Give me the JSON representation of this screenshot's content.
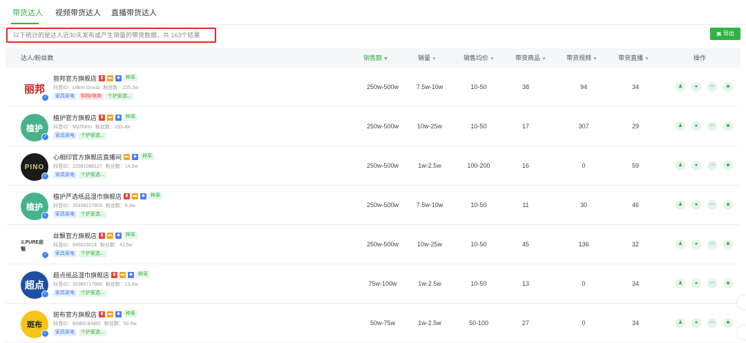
{
  "tabs": [
    {
      "label": "带货达人"
    },
    {
      "label": "视频带货达人"
    },
    {
      "label": "直播带货达人"
    }
  ],
  "notice": "以下统计的是达人近30天发布或产生销量的带货数据，共 163个结果",
  "export_label": "导出",
  "export_icon": "download-icon",
  "columns": {
    "influencer": "达人/粉丝数",
    "sales_amount": "销售额",
    "sales_volume": "销量",
    "avg_price": "销售均价",
    "products": "带货商品",
    "videos": "带货视频",
    "lives": "带货直播",
    "actions": "操作"
  },
  "sorted_column": "sales_amount",
  "accent_color": "#2fb344",
  "rows": [
    {
      "name": "丽邦官方旗舰店",
      "id": "抖音ID：LiBon.Group",
      "fans": "粉丝数：225.2w",
      "tags": [
        "家具家电",
        "购物/电商",
        "个护家选..."
      ],
      "tag_colors": [
        "blue",
        "red",
        "green"
      ],
      "badges": [
        "red",
        "orange",
        "blue"
      ],
      "seed": "种草",
      "avatar_text": "丽邦",
      "avatar_style": "libang",
      "sales_amount": "250w-500w",
      "sales_volume": "7.5w-10w",
      "avg_price": "10-50",
      "products": "38",
      "videos": "94",
      "lives": "34"
    },
    {
      "name": "植护官方旗舰店",
      "id": "抖音ID：MyZhiHu",
      "fans": "粉丝数：233.4w",
      "tags": [
        "家具家电",
        "个护家选..."
      ],
      "tag_colors": [
        "blue",
        "green"
      ],
      "badges": [
        "red",
        "orange",
        "blue"
      ],
      "seed": "种草",
      "avatar_text": "植护",
      "avatar_style": "zhihu",
      "sales_amount": "250w-500w",
      "sales_volume": "10w-25w",
      "avg_price": "10-50",
      "products": "17",
      "videos": "307",
      "lives": "29"
    },
    {
      "name": "心相印官方旗舰店直播间",
      "id": "抖音ID：22581088127",
      "fans": "粉丝数：14.2w",
      "tags": [
        "家具家电",
        "个护家选..."
      ],
      "tag_colors": [
        "blue",
        "green"
      ],
      "badges": [
        "orange",
        "blue"
      ],
      "seed": "种草",
      "avatar_text": "PINO",
      "avatar_style": "pino",
      "sales_amount": "250w-500w",
      "sales_volume": "1w-2.5w",
      "avg_price": "100-200",
      "products": "16",
      "videos": "0",
      "lives": "59"
    },
    {
      "name": "植护严选纸品湿巾旗舰店",
      "id": "抖音ID：25438217603",
      "fans": "粉丝数：8.3w",
      "tags": [
        "家具家电",
        "个护家选..."
      ],
      "tag_colors": [
        "blue",
        "green"
      ],
      "badges": [
        "red",
        "orange",
        "blue"
      ],
      "seed": "种草",
      "avatar_text": "植护",
      "avatar_style": "zhihu",
      "sales_amount": "250w-500w",
      "sales_volume": "7.5w-10w",
      "avg_price": "10-50",
      "products": "11",
      "videos": "30",
      "lives": "46"
    },
    {
      "name": "丝飘官方旗舰店",
      "id": "抖音ID：845023014",
      "fans": "粉丝数：41.5w",
      "tags": [
        "家具家电",
        "个护家选..."
      ],
      "tag_colors": [
        "blue",
        "green"
      ],
      "badges": [
        "red",
        "orange",
        "blue"
      ],
      "seed": "种草",
      "avatar_text": "S.PURE丝飘",
      "avatar_style": "spure",
      "sales_amount": "250w-500w",
      "sales_volume": "10w-25w",
      "avg_price": "10-50",
      "products": "45",
      "videos": "136",
      "lives": "32"
    },
    {
      "name": "超点纸品湿巾旗舰店",
      "id": "抖音ID：35385717686",
      "fans": "粉丝数：13.0w",
      "tags": [
        "家具家电",
        "个护家选..."
      ],
      "tag_colors": [
        "blue",
        "green"
      ],
      "badges": [
        "red",
        "orange",
        "blue"
      ],
      "seed": "种草",
      "avatar_text": "超点",
      "avatar_style": "chaodian",
      "sales_amount": "75w-100w",
      "sales_volume": "1w-2.5w",
      "avg_price": "10-50",
      "products": "13",
      "videos": "0",
      "lives": "34"
    },
    {
      "name": "斑布官方旗舰店",
      "id": "抖音ID：BABO.BABO",
      "fans": "粉丝数：50.5w",
      "tags": [
        "家具家电",
        "个护家选..."
      ],
      "tag_colors": [
        "blue",
        "green"
      ],
      "badges": [
        "red",
        "orange",
        "blue"
      ],
      "seed": "种草",
      "avatar_text": "斑布",
      "avatar_style": "babo",
      "sales_amount": "50w-75w",
      "sales_volume": "1w-2.5w",
      "avg_price": "50-100",
      "products": "27",
      "videos": "0",
      "lives": "34"
    }
  ],
  "row_actions": [
    {
      "icon": "person-icon"
    },
    {
      "icon": "video-icon"
    },
    {
      "icon": "trend-icon"
    },
    {
      "icon": "users-icon"
    }
  ]
}
